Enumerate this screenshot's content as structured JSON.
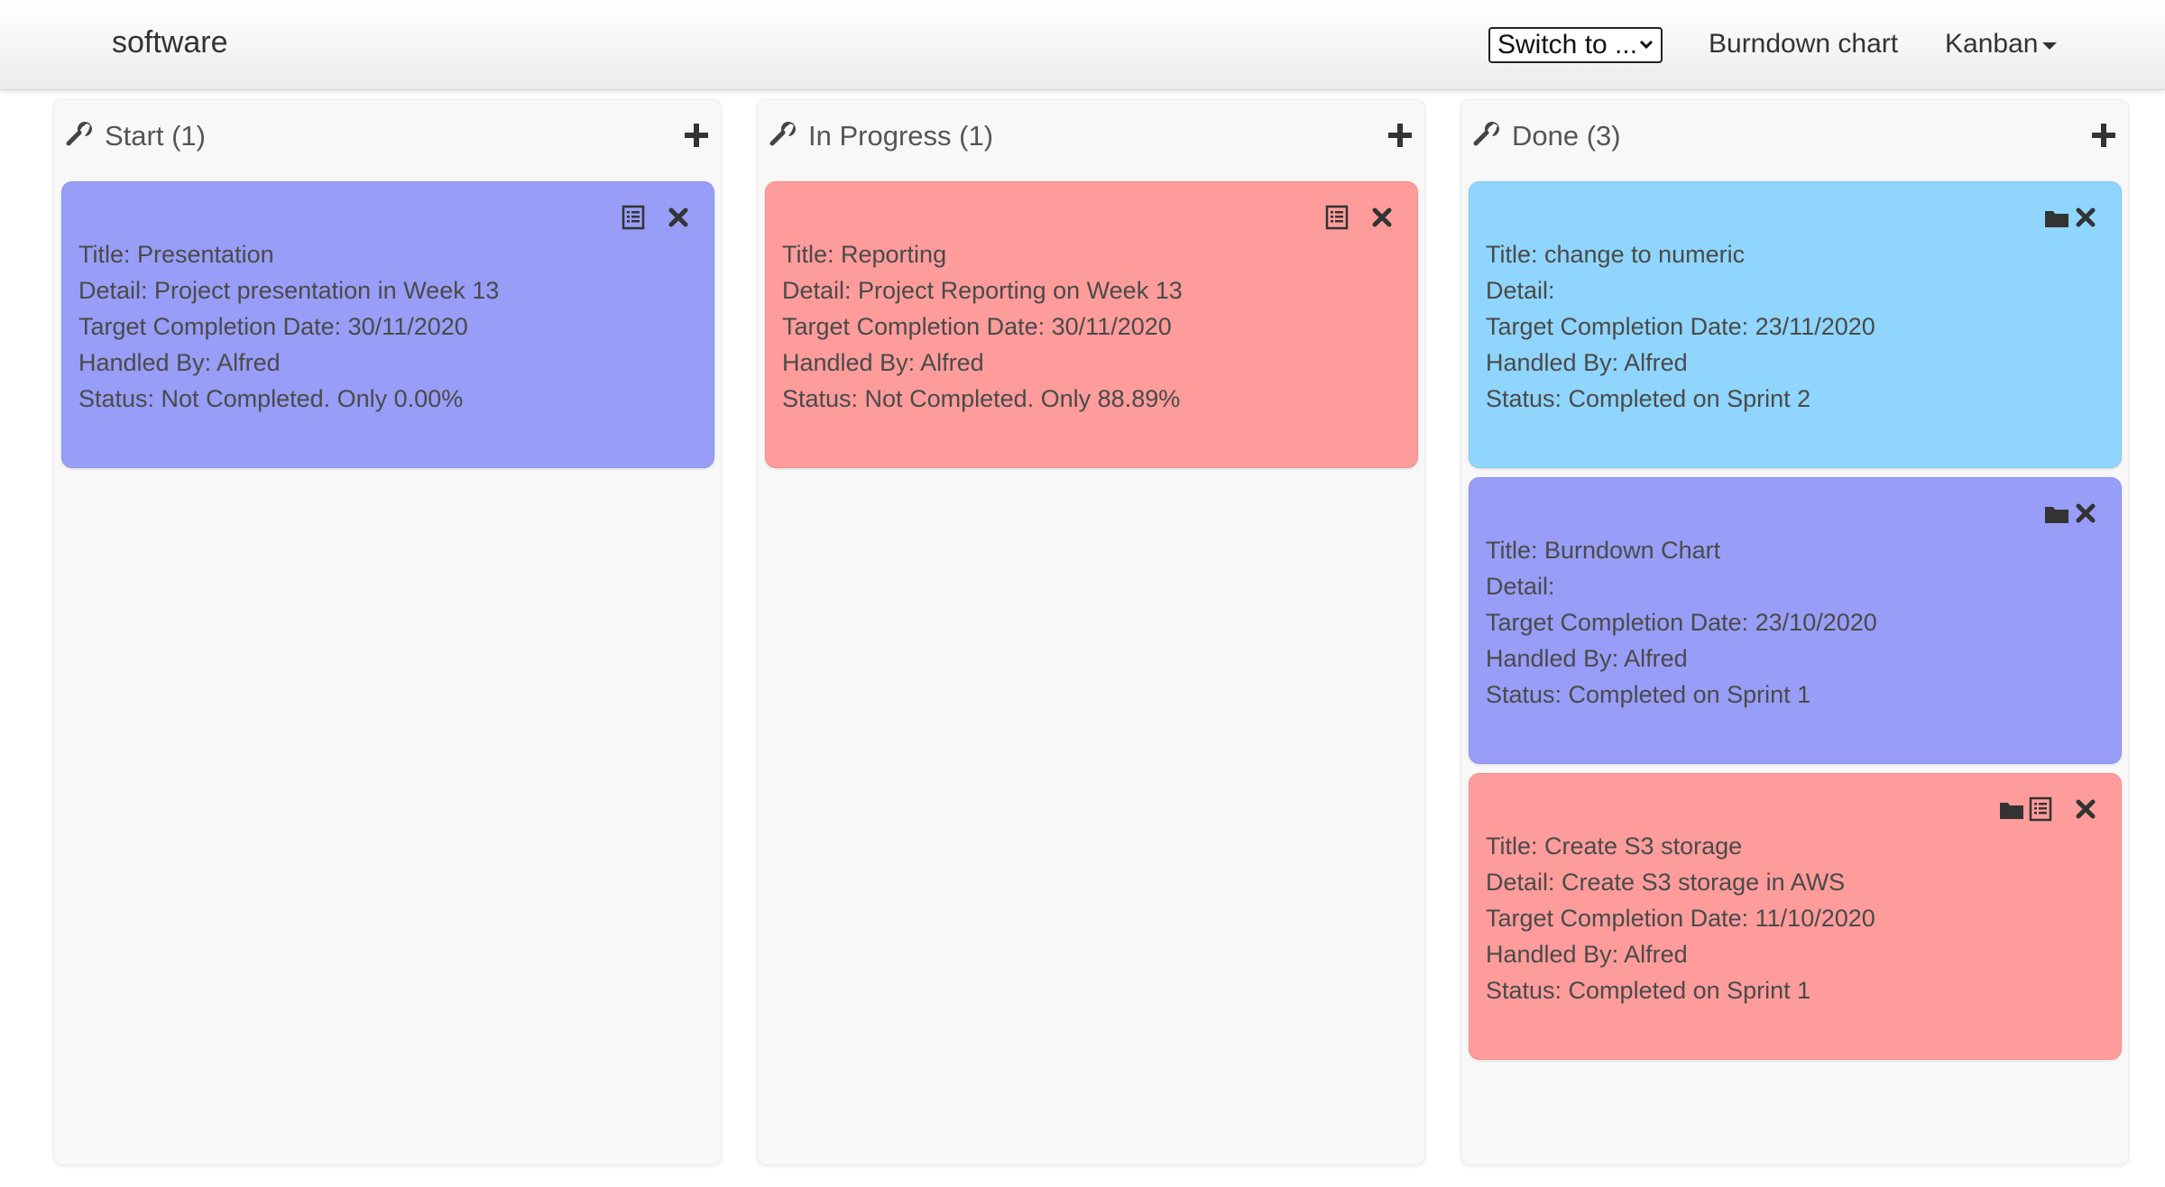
{
  "navbar": {
    "brand": "software",
    "switch_label": "Switch to ...",
    "burndown_label": "Burndown chart",
    "kanban_label": "Kanban"
  },
  "colors": {
    "card_purple": "#989df7",
    "card_red": "#fd9c9b",
    "card_blue": "#8fd5fc",
    "icon": "#333333"
  },
  "columns": [
    {
      "title": "Start (1)",
      "cards": [
        {
          "color": "purple",
          "icons": [
            "list-icon",
            "close-icon"
          ],
          "title": "Title: Presentation",
          "detail": "Detail: Project presentation in Week 13",
          "target": "Target Completion Date: 30/11/2020",
          "handled": "Handled By: Alfred",
          "status": "Status: Not Completed. Only 0.00%"
        }
      ]
    },
    {
      "title": "In Progress (1)",
      "cards": [
        {
          "color": "red",
          "icons": [
            "list-icon",
            "close-icon"
          ],
          "title": "Title: Reporting",
          "detail": "Detail: Project Reporting on Week 13",
          "target": "Target Completion Date: 30/11/2020",
          "handled": "Handled By: Alfred",
          "status": "Status: Not Completed. Only 88.89%"
        }
      ]
    },
    {
      "title": "Done (3)",
      "cards": [
        {
          "color": "blue",
          "icons": [
            "folder-icon",
            "close-icon"
          ],
          "title": "Title: change to numeric",
          "detail": "Detail:",
          "target": "Target Completion Date: 23/11/2020",
          "handled": "Handled By: Alfred",
          "status": "Status: Completed on Sprint 2"
        },
        {
          "color": "purple",
          "icons": [
            "folder-icon",
            "close-icon"
          ],
          "title": "Title: Burndown Chart",
          "detail": "Detail:",
          "target": "Target Completion Date: 23/10/2020",
          "handled": "Handled By: Alfred",
          "status": "Status: Completed on Sprint 1"
        },
        {
          "color": "red",
          "icons": [
            "folder-icon",
            "list-icon",
            "close-icon"
          ],
          "title": "Title: Create S3 storage",
          "detail": "Detail: Create S3 storage in AWS",
          "target": "Target Completion Date: 11/10/2020",
          "handled": "Handled By: Alfred",
          "status": "Status: Completed on Sprint 1"
        }
      ]
    }
  ]
}
